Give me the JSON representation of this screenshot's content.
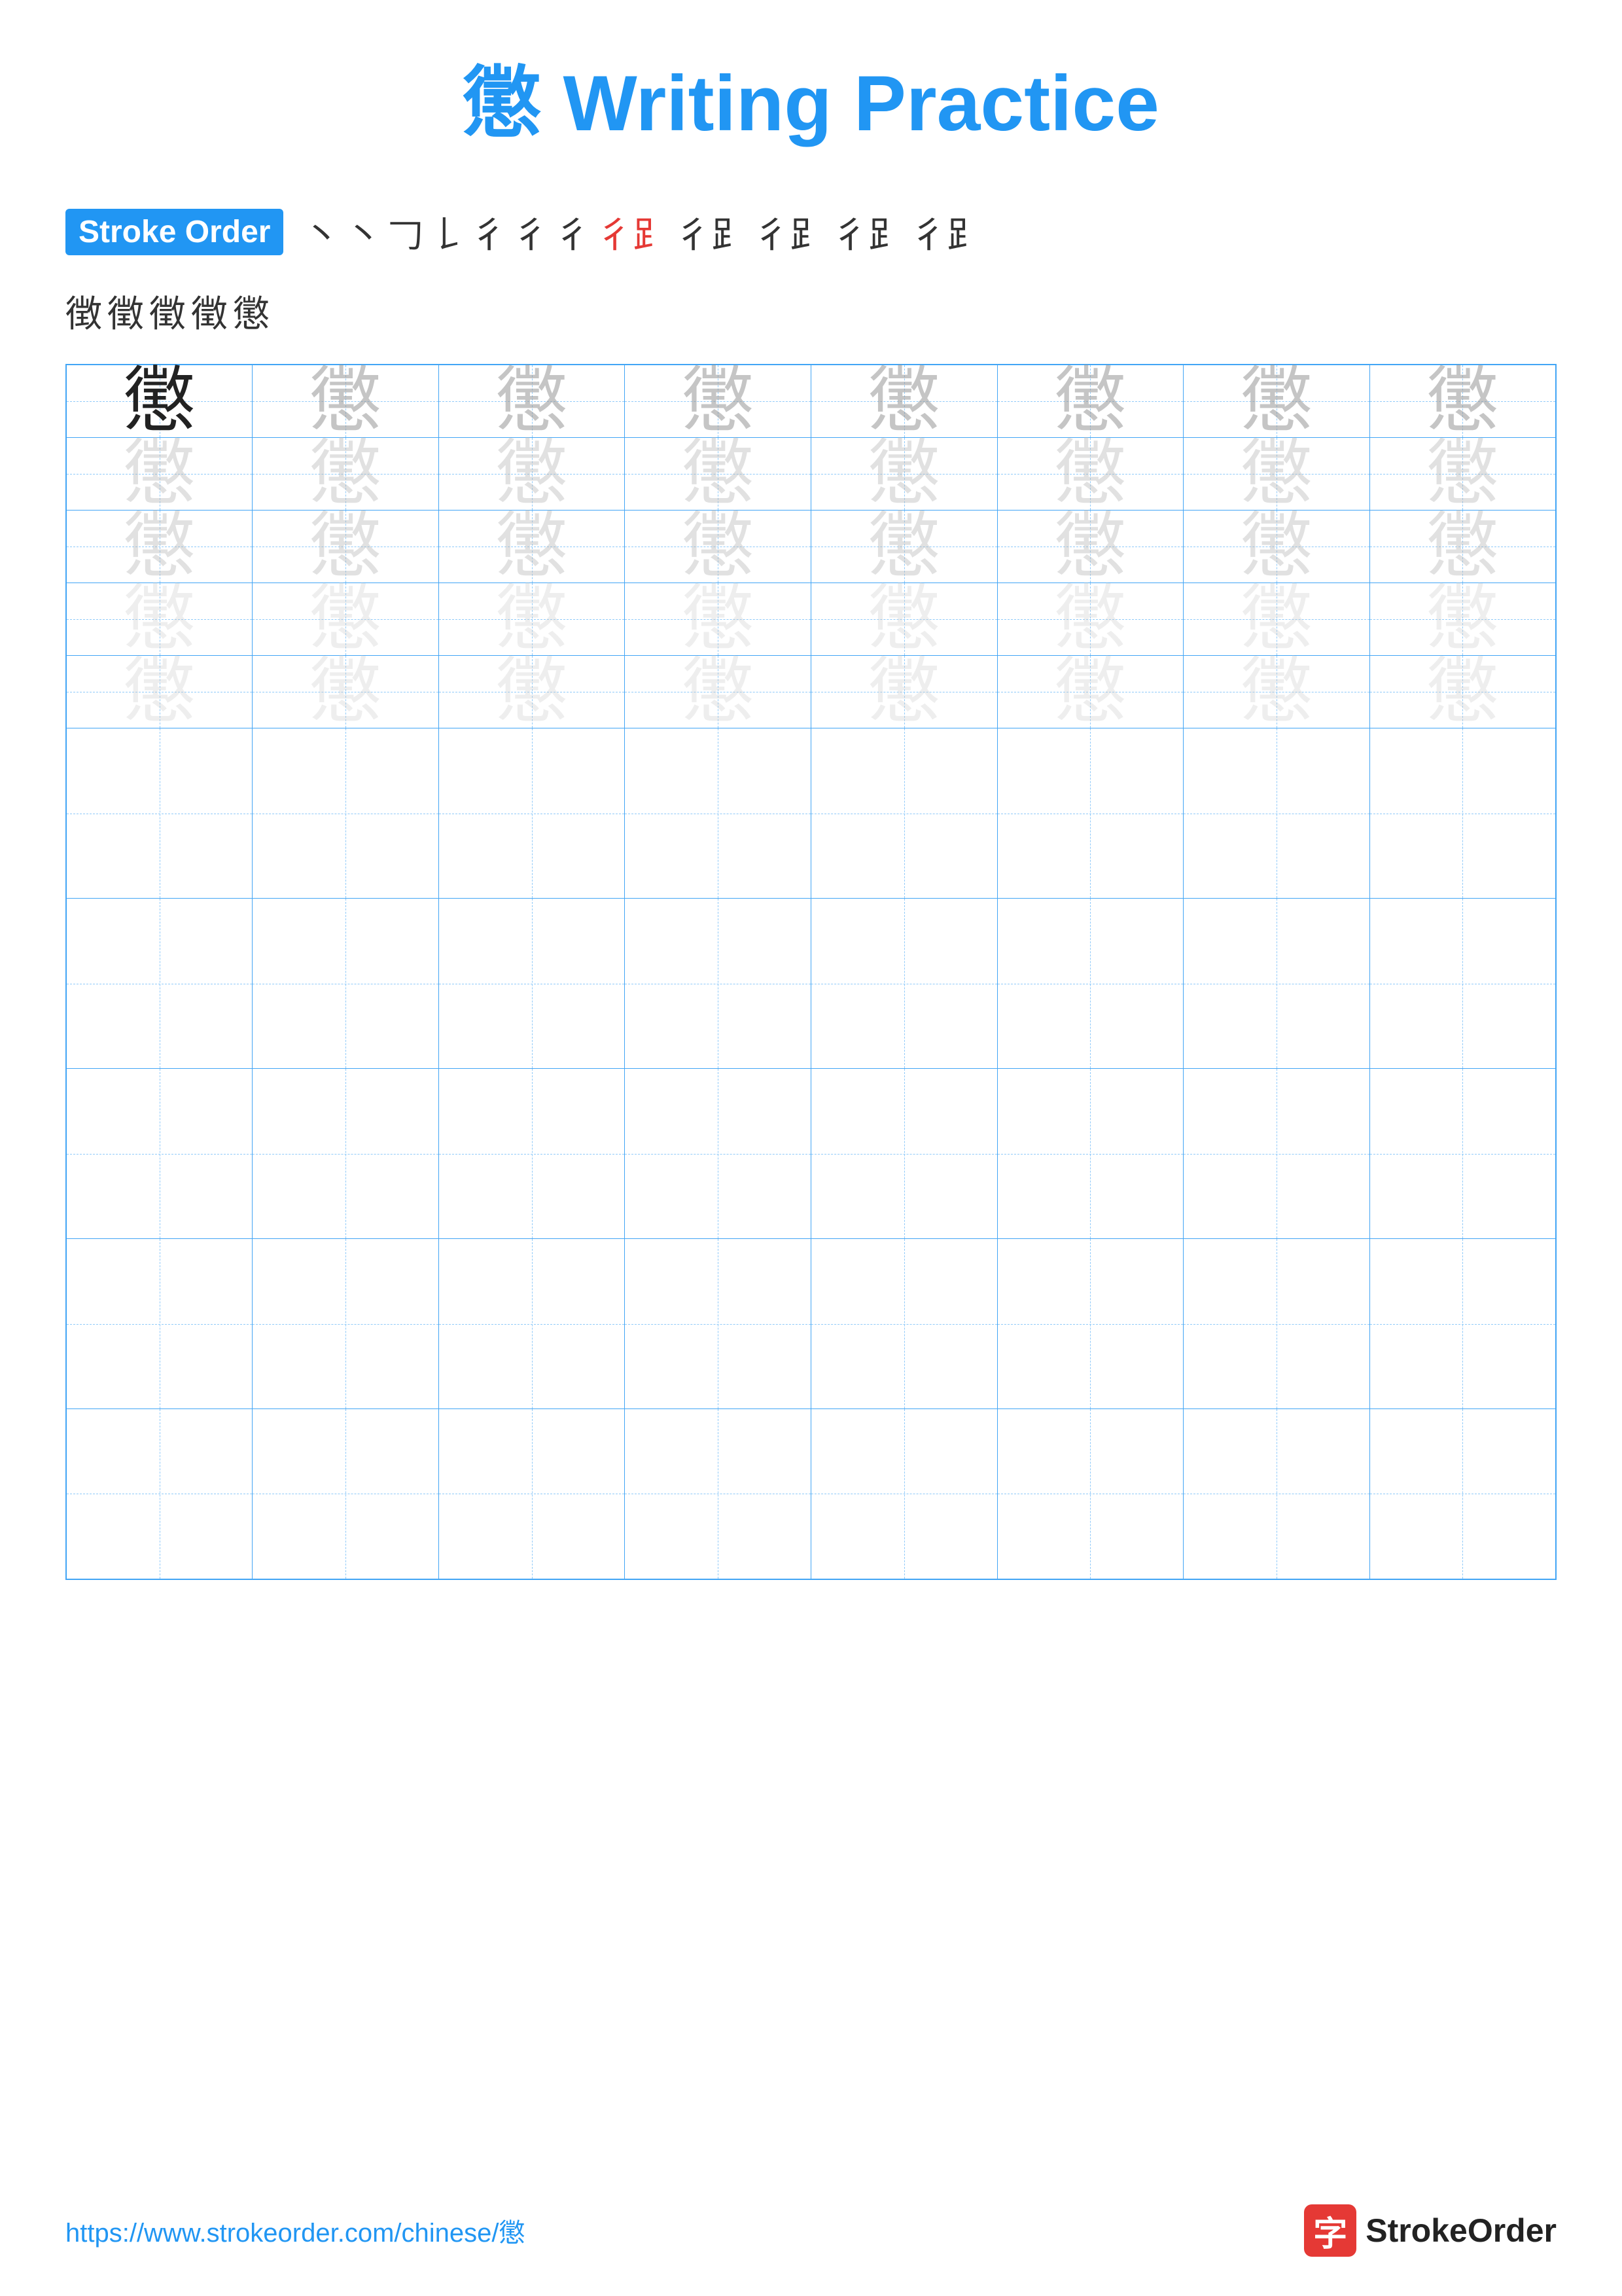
{
  "title": {
    "char": "懲",
    "label": "Writing Practice",
    "full": "懲 Writing Practice"
  },
  "stroke_order": {
    "badge_label": "Stroke Order",
    "strokes": [
      "⼂",
      "⼂",
      "𠃌",
      "𠄌",
      "彳",
      "彳",
      "彳",
      "彳⻊",
      "彳⻊",
      "彳⻊",
      "彳⻊",
      "彳⻊",
      "徴",
      "徵",
      "徵",
      "徵",
      "懲"
    ],
    "row1": [
      "⼂",
      "⼂",
      "𠃌",
      "𠄌",
      "彳",
      "彳",
      "彳",
      "彳⻊",
      "彳⻊",
      "彳⻊",
      "彳⻊",
      "彳⻊"
    ],
    "row2": [
      "徴",
      "徵",
      "徵",
      "徵",
      "懲"
    ]
  },
  "practice": {
    "char": "懲",
    "rows": 10,
    "cols": 8
  },
  "footer": {
    "url": "https://www.strokeorder.com/chinese/懲",
    "logo_char": "字",
    "logo_text": "StrokeOrder"
  }
}
